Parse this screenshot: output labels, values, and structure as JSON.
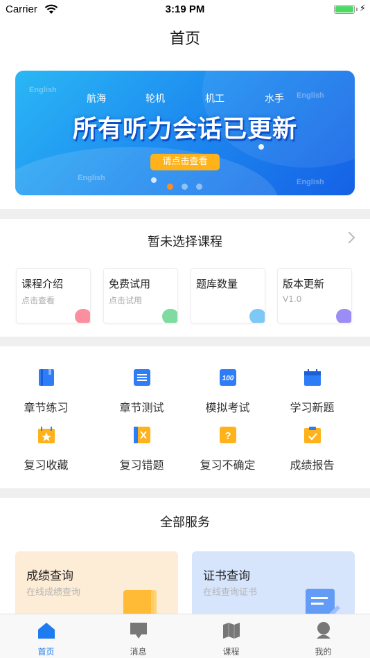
{
  "status_bar": {
    "carrier": "Carrier",
    "time": "3:19 PM"
  },
  "nav": {
    "title": "首页"
  },
  "banner": {
    "english_watermark": "English",
    "categories": [
      "航海",
      "轮机",
      "机工",
      "水手"
    ],
    "headline": "所有听力会话已更新",
    "button": "请点击查看",
    "page_count": 3,
    "active_page": 1
  },
  "course": {
    "title": "暂未选择课程",
    "cards": [
      {
        "title": "课程介绍",
        "subtitle": "点击查看",
        "color": "#fb8fa0"
      },
      {
        "title": "免费试用",
        "subtitle": "点击试用",
        "color": "#7fdba0"
      },
      {
        "title": "题库数量",
        "subtitle": "",
        "color": "#7ec8f5"
      },
      {
        "title": "版本更新",
        "subtitle": "V1.0",
        "color": "#9c8cf5"
      }
    ]
  },
  "features": [
    {
      "label": "章节练习",
      "icon": "book-icon",
      "color": "#2f7df6"
    },
    {
      "label": "章节测试",
      "icon": "list-icon",
      "color": "#2f7df6"
    },
    {
      "label": "模拟考试",
      "icon": "score-100-icon",
      "color": "#2f7df6"
    },
    {
      "label": "学习新题",
      "icon": "calendar-icon",
      "color": "#2f7df6"
    },
    {
      "label": "复习收藏",
      "icon": "star-icon",
      "color": "#ffb21a"
    },
    {
      "label": "复习错题",
      "icon": "wrong-x-icon",
      "color": "#ffb21a"
    },
    {
      "label": "复习不确定",
      "icon": "question-icon",
      "color": "#ffb21a"
    },
    {
      "label": "成绩报告",
      "icon": "report-check-icon",
      "color": "#ffb21a"
    }
  ],
  "services": {
    "title": "全部服务",
    "cards": [
      {
        "title": "成绩查询",
        "subtitle": "在线成绩查询",
        "bg": "#fdecd6",
        "icon": "grade-book-icon",
        "accent": "#ffb21a"
      },
      {
        "title": "证书查询",
        "subtitle": "在线查询证书",
        "bg": "#d6e4fc",
        "icon": "certificate-icon",
        "accent": "#4d8ff5"
      }
    ]
  },
  "tabbar": {
    "items": [
      {
        "label": "首页",
        "icon": "home-icon",
        "active": true
      },
      {
        "label": "消息",
        "icon": "message-icon",
        "active": false
      },
      {
        "label": "课程",
        "icon": "map-icon",
        "active": false
      },
      {
        "label": "我的",
        "icon": "profile-icon",
        "active": false
      }
    ]
  }
}
